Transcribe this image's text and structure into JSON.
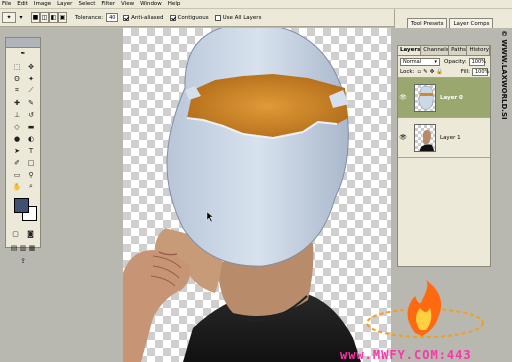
{
  "menubar": {
    "items": [
      "File",
      "Edit",
      "Image",
      "Layer",
      "Select",
      "Filter",
      "View",
      "Window",
      "Help"
    ]
  },
  "options": {
    "tolerance_label": "Tolerance:",
    "tolerance_value": "40",
    "anti_aliased": "Anti-aliased",
    "contiguous": "Contiguous",
    "use_all_layers": "Use All Layers"
  },
  "panel_well": {
    "tabs": [
      "Tool Presets",
      "Layer Comps"
    ]
  },
  "layers_panel": {
    "tabs": [
      "Layers",
      "Channels",
      "Paths",
      "History"
    ],
    "blend_mode": "Normal",
    "opacity_label": "Opacity:",
    "opacity_value": "100%",
    "lock_label": "Lock:",
    "fill_label": "Fill:",
    "fill_value": "100%",
    "layers": [
      {
        "name": "Layer 0",
        "selected": true
      },
      {
        "name": "Layer 1",
        "selected": false
      }
    ],
    "selected_color": "#9aa870"
  },
  "side_watermark": "© WWW.LAXWORLD.SI",
  "bottom_watermark": "www.MWFY.COM:443",
  "colors": {
    "ui_bg": "#ece9d8",
    "foreground_swatch": "#405070",
    "background_swatch": "#ffffff",
    "egg": "#c8d4e4",
    "yolk": "#d08a28",
    "skin": "#c89a78"
  }
}
